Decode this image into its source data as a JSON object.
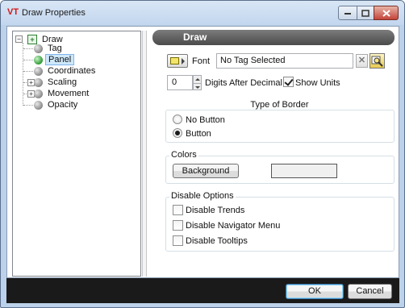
{
  "window": {
    "logo": "VT",
    "title": "Draw Properties",
    "controls": [
      "minimize-icon",
      "maximize-icon",
      "close-icon"
    ]
  },
  "tree": {
    "root": "Draw",
    "items": [
      {
        "label": "Tag",
        "expandable": false,
        "icon": "gray-ball-icon"
      },
      {
        "label": "Panel",
        "expandable": false,
        "icon": "green-ball-icon",
        "selected": true
      },
      {
        "label": "Coordinates",
        "expandable": false,
        "icon": "gray-ball-icon"
      },
      {
        "label": "Scaling",
        "expandable": true,
        "icon": "gray-ball-icon"
      },
      {
        "label": "Movement",
        "expandable": true,
        "icon": "gray-ball-icon"
      },
      {
        "label": "Opacity",
        "expandable": false,
        "icon": "gray-ball-icon"
      }
    ]
  },
  "panel": {
    "header": "Draw",
    "font_label": "Font",
    "font_value": "No Tag Selected",
    "digits_value": "0",
    "digits_label": "Digits After Decimal",
    "show_units_label": "Show Units",
    "show_units_checked": true,
    "border_section_title": "Type of Border",
    "border_options": [
      {
        "label": "No Button",
        "selected": false
      },
      {
        "label": "Button",
        "selected": true
      }
    ],
    "colors_legend": "Colors",
    "background_button": "Background",
    "background_color": "#f0f0f0",
    "disable_legend": "Disable Options",
    "disable_options": [
      {
        "label": "Disable Trends",
        "checked": false
      },
      {
        "label": "Disable Navigator Menu",
        "checked": false
      },
      {
        "label": "Disable Tooltips",
        "checked": false
      }
    ]
  },
  "footer": {
    "ok_label": "OK",
    "cancel_label": "Cancel"
  }
}
